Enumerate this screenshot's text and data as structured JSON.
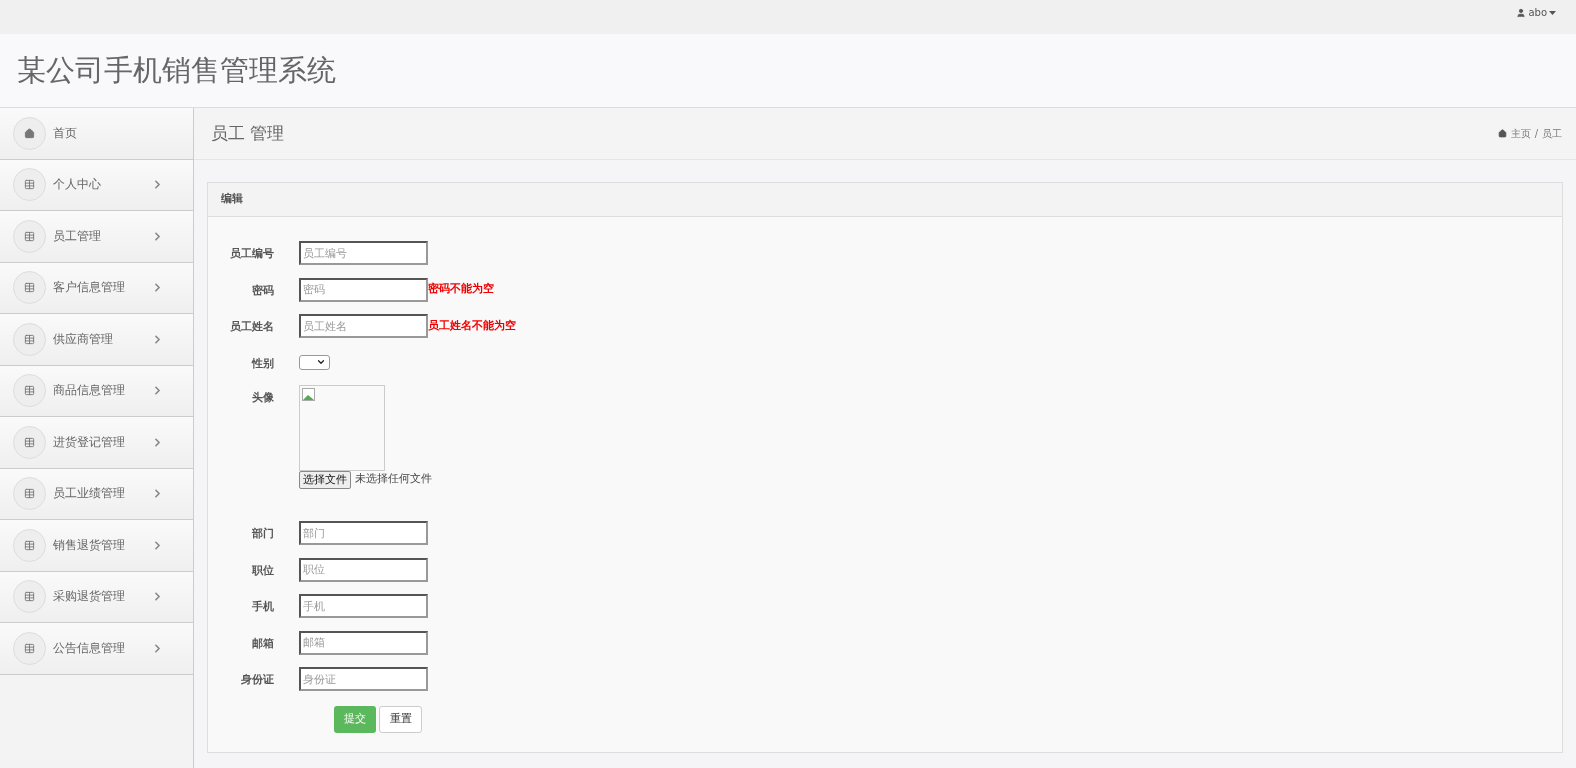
{
  "topbar": {
    "user": "abo"
  },
  "header": {
    "title": "某公司手机销售管理系统"
  },
  "sidebar": {
    "items": [
      {
        "kind": "home",
        "label": "首页"
      },
      {
        "kind": "group",
        "label": "个人中心"
      },
      {
        "kind": "group",
        "label": "员工管理"
      },
      {
        "kind": "group",
        "label": "客户信息管理"
      },
      {
        "kind": "group",
        "label": "供应商管理"
      },
      {
        "kind": "group",
        "label": "商品信息管理"
      },
      {
        "kind": "group",
        "label": "进货登记管理"
      },
      {
        "kind": "group",
        "label": "员工业绩管理"
      },
      {
        "kind": "group",
        "label": "销售退货管理"
      },
      {
        "kind": "group",
        "label": "采购退货管理"
      },
      {
        "kind": "group",
        "label": "公告信息管理"
      }
    ]
  },
  "page": {
    "title": "员工 管理",
    "breadcrumb": [
      "主页",
      "员工"
    ],
    "separator": "/"
  },
  "panel": {
    "title": "编辑"
  },
  "form": {
    "fields": [
      {
        "kind": "text",
        "label": "员工编号",
        "placeholder": "员工编号"
      },
      {
        "kind": "text",
        "label": "密码",
        "placeholder": "密码",
        "error": "密码不能为空"
      },
      {
        "kind": "text",
        "label": "员工姓名",
        "placeholder": "员工姓名",
        "error": "员工姓名不能为空"
      },
      {
        "kind": "select",
        "label": "性别"
      },
      {
        "kind": "image",
        "label": "头像",
        "button": "选择文件",
        "status": "未选择任何文件"
      },
      {
        "kind": "text",
        "label": "部门",
        "placeholder": "部门"
      },
      {
        "kind": "text",
        "label": "职位",
        "placeholder": "职位"
      },
      {
        "kind": "text",
        "label": "手机",
        "placeholder": "手机"
      },
      {
        "kind": "text",
        "label": "邮箱",
        "placeholder": "邮箱"
      },
      {
        "kind": "text",
        "label": "身份证",
        "placeholder": "身份证"
      }
    ],
    "buttons": [
      {
        "kind": "primary",
        "label": "提交"
      },
      {
        "kind": "default",
        "label": "重置"
      }
    ]
  }
}
